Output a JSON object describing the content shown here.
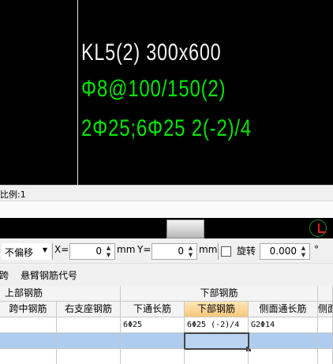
{
  "canvas": {
    "line1": "KL5(2) 300x600",
    "line2": "Φ8@100/150(2)",
    "line3": "2Φ25;6Φ25 2(-2)/4"
  },
  "status": {
    "scale": "比例:1"
  },
  "toolbar": {
    "offset_value": "不偏移",
    "x_label": "X=",
    "x_value": "0",
    "mm1": "mm",
    "y_label": "Y=",
    "y_value": "0",
    "mm2": "mm",
    "rotate_label": "旋转",
    "rotate_value": "0.000",
    "degree": "°"
  },
  "tabs": {
    "left": "跨",
    "cantilever": "悬臂钢筋代号"
  },
  "grid": {
    "groups": {
      "upper": "上部钢筋",
      "lower": "下部钢筋"
    },
    "columns": {
      "mid": "跨中钢筋",
      "right_support": "右支座钢筋",
      "lower_through": "下通长筋",
      "lower_rebar": "下部钢筋",
      "side_through": "侧面通长筋",
      "side_partial": "侧面"
    },
    "row1": {
      "lower_through": "6\b25",
      "lower_rebar": "6\b25 (-2)/4",
      "side_through": "G2\b14"
    }
  }
}
